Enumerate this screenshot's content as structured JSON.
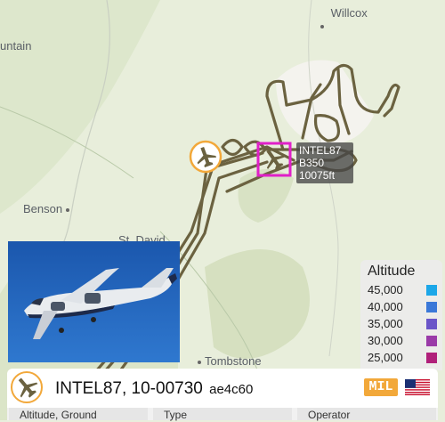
{
  "map": {
    "places": [
      {
        "name": "Willcox",
        "id": "willcox"
      },
      {
        "name": "untain",
        "id": "mountain"
      },
      {
        "name": "Benson",
        "id": "benson"
      },
      {
        "name": "St. David",
        "id": "st-david"
      },
      {
        "name": "Tombstone",
        "id": "tombstone"
      }
    ]
  },
  "aircraft_label": {
    "callsign": "INTEL87",
    "type": "B350",
    "altitude": "10075ft"
  },
  "legend": {
    "title": "Altitude",
    "entries": [
      {
        "value": "45,000",
        "color": "#1ca7e8"
      },
      {
        "value": "40,000",
        "color": "#3a78d8"
      },
      {
        "value": "35,000",
        "color": "#6a55c8"
      },
      {
        "value": "30,000",
        "color": "#9a3aa8"
      },
      {
        "value": "25,000",
        "color": "#b0207a"
      }
    ]
  },
  "info_panel": {
    "callsign": "INTEL87, 10-00730",
    "hex": "ae4c60",
    "badge": "MIL",
    "flag_icon": "us-flag-icon",
    "columns": [
      {
        "label": "Altitude, Ground"
      },
      {
        "label": "Type"
      },
      {
        "label": "Operator"
      }
    ]
  },
  "colors": {
    "track": "#6b6240",
    "selection": "#e020c8",
    "accent": "#f2a83a"
  }
}
